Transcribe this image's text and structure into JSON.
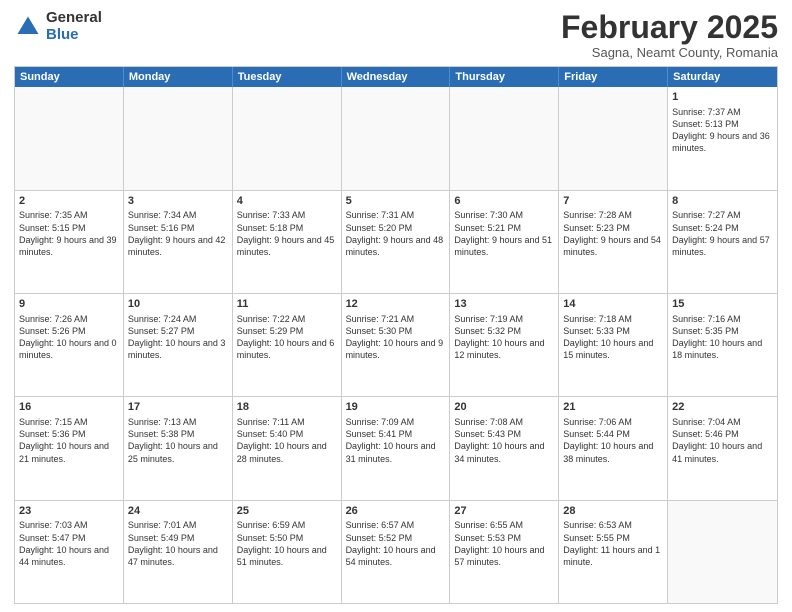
{
  "logo": {
    "general": "General",
    "blue": "Blue"
  },
  "header": {
    "month": "February 2025",
    "location": "Sagna, Neamt County, Romania"
  },
  "weekdays": [
    "Sunday",
    "Monday",
    "Tuesday",
    "Wednesday",
    "Thursday",
    "Friday",
    "Saturday"
  ],
  "rows": [
    [
      {
        "day": "",
        "text": ""
      },
      {
        "day": "",
        "text": ""
      },
      {
        "day": "",
        "text": ""
      },
      {
        "day": "",
        "text": ""
      },
      {
        "day": "",
        "text": ""
      },
      {
        "day": "",
        "text": ""
      },
      {
        "day": "1",
        "text": "Sunrise: 7:37 AM\nSunset: 5:13 PM\nDaylight: 9 hours and 36 minutes."
      }
    ],
    [
      {
        "day": "2",
        "text": "Sunrise: 7:35 AM\nSunset: 5:15 PM\nDaylight: 9 hours and 39 minutes."
      },
      {
        "day": "3",
        "text": "Sunrise: 7:34 AM\nSunset: 5:16 PM\nDaylight: 9 hours and 42 minutes."
      },
      {
        "day": "4",
        "text": "Sunrise: 7:33 AM\nSunset: 5:18 PM\nDaylight: 9 hours and 45 minutes."
      },
      {
        "day": "5",
        "text": "Sunrise: 7:31 AM\nSunset: 5:20 PM\nDaylight: 9 hours and 48 minutes."
      },
      {
        "day": "6",
        "text": "Sunrise: 7:30 AM\nSunset: 5:21 PM\nDaylight: 9 hours and 51 minutes."
      },
      {
        "day": "7",
        "text": "Sunrise: 7:28 AM\nSunset: 5:23 PM\nDaylight: 9 hours and 54 minutes."
      },
      {
        "day": "8",
        "text": "Sunrise: 7:27 AM\nSunset: 5:24 PM\nDaylight: 9 hours and 57 minutes."
      }
    ],
    [
      {
        "day": "9",
        "text": "Sunrise: 7:26 AM\nSunset: 5:26 PM\nDaylight: 10 hours and 0 minutes."
      },
      {
        "day": "10",
        "text": "Sunrise: 7:24 AM\nSunset: 5:27 PM\nDaylight: 10 hours and 3 minutes."
      },
      {
        "day": "11",
        "text": "Sunrise: 7:22 AM\nSunset: 5:29 PM\nDaylight: 10 hours and 6 minutes."
      },
      {
        "day": "12",
        "text": "Sunrise: 7:21 AM\nSunset: 5:30 PM\nDaylight: 10 hours and 9 minutes."
      },
      {
        "day": "13",
        "text": "Sunrise: 7:19 AM\nSunset: 5:32 PM\nDaylight: 10 hours and 12 minutes."
      },
      {
        "day": "14",
        "text": "Sunrise: 7:18 AM\nSunset: 5:33 PM\nDaylight: 10 hours and 15 minutes."
      },
      {
        "day": "15",
        "text": "Sunrise: 7:16 AM\nSunset: 5:35 PM\nDaylight: 10 hours and 18 minutes."
      }
    ],
    [
      {
        "day": "16",
        "text": "Sunrise: 7:15 AM\nSunset: 5:36 PM\nDaylight: 10 hours and 21 minutes."
      },
      {
        "day": "17",
        "text": "Sunrise: 7:13 AM\nSunset: 5:38 PM\nDaylight: 10 hours and 25 minutes."
      },
      {
        "day": "18",
        "text": "Sunrise: 7:11 AM\nSunset: 5:40 PM\nDaylight: 10 hours and 28 minutes."
      },
      {
        "day": "19",
        "text": "Sunrise: 7:09 AM\nSunset: 5:41 PM\nDaylight: 10 hours and 31 minutes."
      },
      {
        "day": "20",
        "text": "Sunrise: 7:08 AM\nSunset: 5:43 PM\nDaylight: 10 hours and 34 minutes."
      },
      {
        "day": "21",
        "text": "Sunrise: 7:06 AM\nSunset: 5:44 PM\nDaylight: 10 hours and 38 minutes."
      },
      {
        "day": "22",
        "text": "Sunrise: 7:04 AM\nSunset: 5:46 PM\nDaylight: 10 hours and 41 minutes."
      }
    ],
    [
      {
        "day": "23",
        "text": "Sunrise: 7:03 AM\nSunset: 5:47 PM\nDaylight: 10 hours and 44 minutes."
      },
      {
        "day": "24",
        "text": "Sunrise: 7:01 AM\nSunset: 5:49 PM\nDaylight: 10 hours and 47 minutes."
      },
      {
        "day": "25",
        "text": "Sunrise: 6:59 AM\nSunset: 5:50 PM\nDaylight: 10 hours and 51 minutes."
      },
      {
        "day": "26",
        "text": "Sunrise: 6:57 AM\nSunset: 5:52 PM\nDaylight: 10 hours and 54 minutes."
      },
      {
        "day": "27",
        "text": "Sunrise: 6:55 AM\nSunset: 5:53 PM\nDaylight: 10 hours and 57 minutes."
      },
      {
        "day": "28",
        "text": "Sunrise: 6:53 AM\nSunset: 5:55 PM\nDaylight: 11 hours and 1 minute."
      },
      {
        "day": "",
        "text": ""
      }
    ]
  ]
}
